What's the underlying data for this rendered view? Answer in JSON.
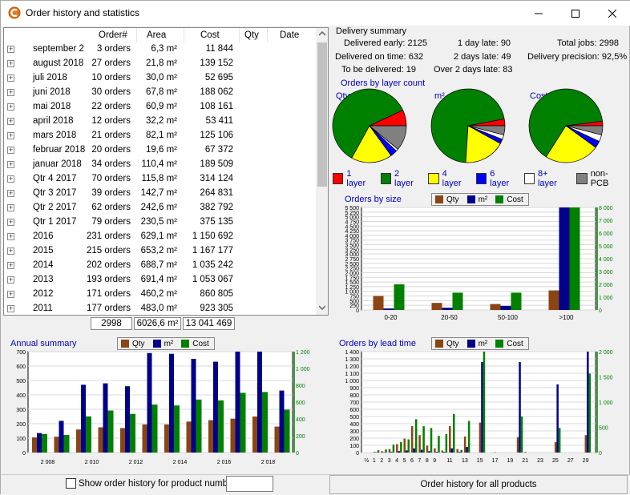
{
  "window": {
    "title": "Order history and statistics"
  },
  "table": {
    "headers": [
      "Order#",
      "Area",
      "Cost",
      "Qty",
      "Date"
    ],
    "rows": [
      {
        "period": "september 2",
        "orders": "3 orders",
        "area": "6,3 m²",
        "cost": "11 844"
      },
      {
        "period": "august 2018",
        "orders": "27 orders",
        "area": "21,8 m²",
        "cost": "139 152"
      },
      {
        "period": "juli 2018",
        "orders": "10 orders",
        "area": "30,0 m²",
        "cost": "52 695"
      },
      {
        "period": "juni 2018",
        "orders": "30 orders",
        "area": "67,8 m²",
        "cost": "188 062"
      },
      {
        "period": "mai 2018",
        "orders": "22 orders",
        "area": "60,9 m²",
        "cost": "108 161"
      },
      {
        "period": "april 2018",
        "orders": "12 orders",
        "area": "32,2 m²",
        "cost": "53 411"
      },
      {
        "period": "mars 2018",
        "orders": "21 orders",
        "area": "82,1 m²",
        "cost": "125 106"
      },
      {
        "period": "februar 2018",
        "orders": "20 orders",
        "area": "19,6 m²",
        "cost": "67 372"
      },
      {
        "period": "januar 2018",
        "orders": "34 orders",
        "area": "110,4 m²",
        "cost": "189 509"
      },
      {
        "period": "Qtr 4 2017",
        "orders": "70 orders",
        "area": "115,8 m²",
        "cost": "314 124"
      },
      {
        "period": "Qtr 3 2017",
        "orders": "39 orders",
        "area": "142,7 m²",
        "cost": "264 831"
      },
      {
        "period": "Qtr 2 2017",
        "orders": "62 orders",
        "area": "242,6 m²",
        "cost": "382 792"
      },
      {
        "period": "Qtr 1 2017",
        "orders": "79 orders",
        "area": "230,5 m²",
        "cost": "375 135"
      },
      {
        "period": "2016",
        "orders": "231 orders",
        "area": "629,1 m²",
        "cost": "1 150 692"
      },
      {
        "period": "2015",
        "orders": "215 orders",
        "area": "653,2 m²",
        "cost": "1 167 177"
      },
      {
        "period": "2014",
        "orders": "202 orders",
        "area": "688,7 m²",
        "cost": "1 035 242"
      },
      {
        "period": "2013",
        "orders": "193 orders",
        "area": "691,4 m²",
        "cost": "1 053 067"
      },
      {
        "period": "2012",
        "orders": "171 orders",
        "area": "460,2 m²",
        "cost": "860 805"
      },
      {
        "period": "2011",
        "orders": "177 orders",
        "area": "483,0 m²",
        "cost": "923 305"
      }
    ],
    "totals": {
      "orders": "2998",
      "area": "6026,6 m²",
      "cost": "13 041 469"
    }
  },
  "delivery": {
    "title": "Delivery summary",
    "early": "Delivered early: 2125",
    "ontime": "Delivered on time: 632",
    "tobe": "To be delivered: 19",
    "late1": "1 day late: 90",
    "late2": "2 days late: 49",
    "late3": "Over 2 days late: 83",
    "jobs": "Total jobs: 2998",
    "precision": "Delivery precision: 92,5%"
  },
  "layer_section": {
    "title": "Orders by layer count",
    "pie_titles": [
      "Qty",
      "m²",
      "Cost"
    ],
    "legend": [
      "1 layer",
      "2 layer",
      "4 layer",
      "6 layer",
      "8+ layer",
      "non-PCB"
    ],
    "colors": [
      "#ff0000",
      "#008000",
      "#ffff00",
      "#0000ff",
      "#ffffff",
      "#808080"
    ]
  },
  "series_legend": {
    "qty": "Qty",
    "m2": "m²",
    "cost": "Cost"
  },
  "series_colors": {
    "qty": "#8b4513",
    "m2": "#00008b",
    "cost": "#008000"
  },
  "section_titles": {
    "size": "Orders by size",
    "annual": "Annual summary",
    "lead": "Orders by lead time"
  },
  "bottom": {
    "show_label": "Show order history for product number",
    "product_value": "",
    "all_button": "Order history for all products"
  },
  "chart_data": [
    {
      "type": "pie",
      "title": "Qty",
      "labels": [
        "1 layer",
        "2 layer",
        "4 layer",
        "6 layer",
        "8+ layer",
        "non-PCB"
      ],
      "values": [
        7,
        60,
        18,
        3,
        1,
        11
      ]
    },
    {
      "type": "pie",
      "title": "m²",
      "labels": [
        "1 layer",
        "2 layer",
        "4 layer",
        "6 layer",
        "8+ layer",
        "non-PCB"
      ],
      "values": [
        3,
        71,
        18,
        2,
        2,
        4
      ]
    },
    {
      "type": "pie",
      "title": "Cost",
      "labels": [
        "1 layer",
        "2 layer",
        "4 layer",
        "6 layer",
        "8+ layer",
        "non-PCB"
      ],
      "values": [
        2,
        64,
        24,
        3,
        3,
        4
      ]
    },
    {
      "type": "bar",
      "title": "Orders by size",
      "categories": [
        "0-20",
        "20-50",
        "50-100",
        ">100"
      ],
      "series": [
        {
          "name": "Qty",
          "values": [
            750,
            380,
            320,
            1050
          ]
        },
        {
          "name": "m²",
          "values": [
            80,
            120,
            220,
            5500
          ]
        },
        {
          "name": "Cost",
          "values": [
            2000,
            1350,
            1350,
            8000
          ]
        }
      ],
      "y_left": {
        "ticks": [
          "0",
          "250",
          "500",
          "750",
          "1 000",
          "1 250",
          "1 500",
          "1 750",
          "2 000",
          "2 250",
          "2 500",
          "2 750",
          "3 000",
          "3 250",
          "3 500",
          "3 750",
          "4 000",
          "4 250",
          "4 500",
          "4 750",
          "5 000",
          "5 250",
          "5 500"
        ],
        "max": 5500
      },
      "y_right": {
        "ticks": [
          "0",
          "1 000",
          "2 000",
          "3 000",
          "4 000",
          "5 000",
          "6 000",
          "7 000",
          "8 000"
        ],
        "max": 8000
      }
    },
    {
      "type": "bar",
      "title": "Annual summary",
      "x_ticks": [
        "2 008",
        "2 010",
        "2 012",
        "2 014",
        "2 016",
        "2 018"
      ],
      "categories": [
        "2007",
        "2008",
        "2009",
        "2010",
        "2011",
        "2012",
        "2013",
        "2014",
        "2015",
        "2016",
        "2017",
        "2018"
      ],
      "series": [
        {
          "name": "Qty",
          "values": [
            105,
            110,
            160,
            175,
            170,
            195,
            195,
            215,
            225,
            235,
            250,
            180
          ]
        },
        {
          "name": "m²",
          "values": [
            135,
            220,
            470,
            480,
            460,
            690,
            685,
            650,
            630,
            720,
            720,
            430
          ]
        },
        {
          "name": "Cost",
          "values": [
            220,
            210,
            430,
            500,
            460,
            570,
            560,
            630,
            620,
            710,
            720,
            510
          ]
        }
      ],
      "y_left": {
        "ticks": [
          "0",
          "100",
          "200",
          "300",
          "400",
          "500",
          "600",
          "700"
        ],
        "max": 700
      },
      "y_right": {
        "ticks": [
          "0",
          "200",
          "400",
          "600",
          "800",
          "1 000",
          "1 200"
        ],
        "max": 1200
      }
    },
    {
      "type": "bar",
      "title": "Orders by lead time",
      "x_ticks": [
        "½",
        "1",
        "2",
        "3",
        "4",
        "5",
        "6",
        "7",
        "8",
        "9",
        "11",
        "13",
        "15",
        "17",
        "19",
        "21",
        "23",
        "25",
        "27",
        "29"
      ],
      "series": [
        {
          "name": "Qty",
          "points": [
            [
              2,
              10
            ],
            [
              3,
              20
            ],
            [
              4,
              50
            ],
            [
              5,
              120
            ],
            [
              6,
              200
            ],
            [
              7,
              380
            ],
            [
              8,
              250
            ],
            [
              9,
              100
            ],
            [
              10,
              60
            ],
            [
              11,
              30
            ],
            [
              12,
              380
            ],
            [
              13,
              50
            ],
            [
              14,
              230
            ],
            [
              16,
              430
            ],
            [
              18,
              5
            ],
            [
              21,
              220
            ],
            [
              22,
              10
            ],
            [
              26,
              150
            ],
            [
              30,
              250
            ]
          ]
        },
        {
          "name": "m²",
          "points": [
            [
              2,
              5
            ],
            [
              3,
              5
            ],
            [
              4,
              10
            ],
            [
              5,
              20
            ],
            [
              6,
              30
            ],
            [
              7,
              60
            ],
            [
              8,
              40
            ],
            [
              9,
              20
            ],
            [
              10,
              10
            ],
            [
              11,
              10
            ],
            [
              12,
              60
            ],
            [
              13,
              10
            ],
            [
              14,
              80
            ],
            [
              16,
              1300
            ],
            [
              21,
              1300
            ],
            [
              26,
              980
            ],
            [
              30,
              1450
            ]
          ]
        },
        {
          "name": "Cost",
          "points": [
            [
              2,
              50
            ],
            [
              3,
              70
            ],
            [
              4,
              180
            ],
            [
              5,
              240
            ],
            [
              6,
              300
            ],
            [
              7,
              760
            ],
            [
              8,
              600
            ],
            [
              9,
              560
            ],
            [
              10,
              380
            ],
            [
              11,
              420
            ],
            [
              12,
              880
            ],
            [
              13,
              60
            ],
            [
              14,
              720
            ],
            [
              16,
              2300
            ],
            [
              21,
              820
            ],
            [
              26,
              560
            ],
            [
              30,
              1800
            ]
          ]
        }
      ],
      "y_left": {
        "ticks": [
          "0",
          "100",
          "200",
          "300",
          "400",
          "500",
          "600",
          "700",
          "800",
          "900",
          "1 000",
          "1 100",
          "1 200",
          "1 300",
          "1 400"
        ],
        "max": 1450
      },
      "y_right": {
        "ticks": [
          "0",
          "500",
          "1 000",
          "1 500",
          "2 000"
        ],
        "max": 2300
      }
    }
  ]
}
